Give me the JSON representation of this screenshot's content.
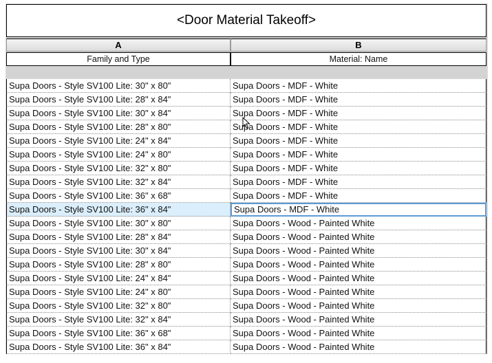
{
  "schedule": {
    "title": "<Door Material Takeoff>",
    "columns": [
      {
        "letter": "A",
        "field": "Family and Type"
      },
      {
        "letter": "B",
        "field": "Material: Name"
      }
    ],
    "rows": [
      {
        "a": "Supa Doors - Style SV100 Lite: 30\" x 80\"",
        "b": "Supa Doors - MDF - White"
      },
      {
        "a": "Supa Doors - Style SV100 Lite: 28\" x 84\"",
        "b": "Supa Doors - MDF - White"
      },
      {
        "a": "Supa Doors - Style SV100 Lite: 30\" x 84\"",
        "b": "Supa Doors - MDF - White"
      },
      {
        "a": "Supa Doors - Style SV100 Lite: 28\" x 80\"",
        "b": "Supa Doors - MDF - White"
      },
      {
        "a": "Supa Doors - Style SV100 Lite: 24\" x 84\"",
        "b": "Supa Doors - MDF - White"
      },
      {
        "a": "Supa Doors - Style SV100 Lite: 24\" x 80\"",
        "b": "Supa Doors - MDF - White"
      },
      {
        "a": "Supa Doors - Style SV100 Lite: 32\" x 80\"",
        "b": "Supa Doors - MDF - White"
      },
      {
        "a": "Supa Doors - Style SV100 Lite: 32\" x 84\"",
        "b": "Supa Doors - MDF - White"
      },
      {
        "a": "Supa Doors - Style SV100 Lite: 36\" x 68\"",
        "b": "Supa Doors - MDF - White"
      },
      {
        "a": "Supa Doors - Style SV100 Lite: 36\" x 84\"",
        "b": "Supa Doors - MDF - White",
        "selected": true
      },
      {
        "a": "Supa Doors - Style SV100 Lite: 30\" x 80\"",
        "b": "Supa Doors - Wood - Painted White"
      },
      {
        "a": "Supa Doors - Style SV100 Lite: 28\" x 84\"",
        "b": "Supa Doors - Wood - Painted White"
      },
      {
        "a": "Supa Doors - Style SV100 Lite: 30\" x 84\"",
        "b": "Supa Doors - Wood - Painted White"
      },
      {
        "a": "Supa Doors - Style SV100 Lite: 28\" x 80\"",
        "b": "Supa Doors - Wood - Painted White"
      },
      {
        "a": "Supa Doors - Style SV100 Lite: 24\" x 84\"",
        "b": "Supa Doors - Wood - Painted White"
      },
      {
        "a": "Supa Doors - Style SV100 Lite: 24\" x 80\"",
        "b": "Supa Doors - Wood - Painted White"
      },
      {
        "a": "Supa Doors - Style SV100 Lite: 32\" x 80\"",
        "b": "Supa Doors - Wood - Painted White"
      },
      {
        "a": "Supa Doors - Style SV100 Lite: 32\" x 84\"",
        "b": "Supa Doors - Wood - Painted White"
      },
      {
        "a": "Supa Doors - Style SV100 Lite: 36\" x 68\"",
        "b": "Supa Doors - Wood - Painted White"
      },
      {
        "a": "Supa Doors - Style SV100 Lite: 36\" x 84\"",
        "b": "Supa Doors - Wood - Painted White"
      }
    ]
  },
  "colors": {
    "selection_fill": "#dbeefb",
    "selection_border": "#5b9bd5",
    "header_gray": "#dcdcdc"
  },
  "icons": {
    "pointer": "mouse-pointer-icon"
  }
}
